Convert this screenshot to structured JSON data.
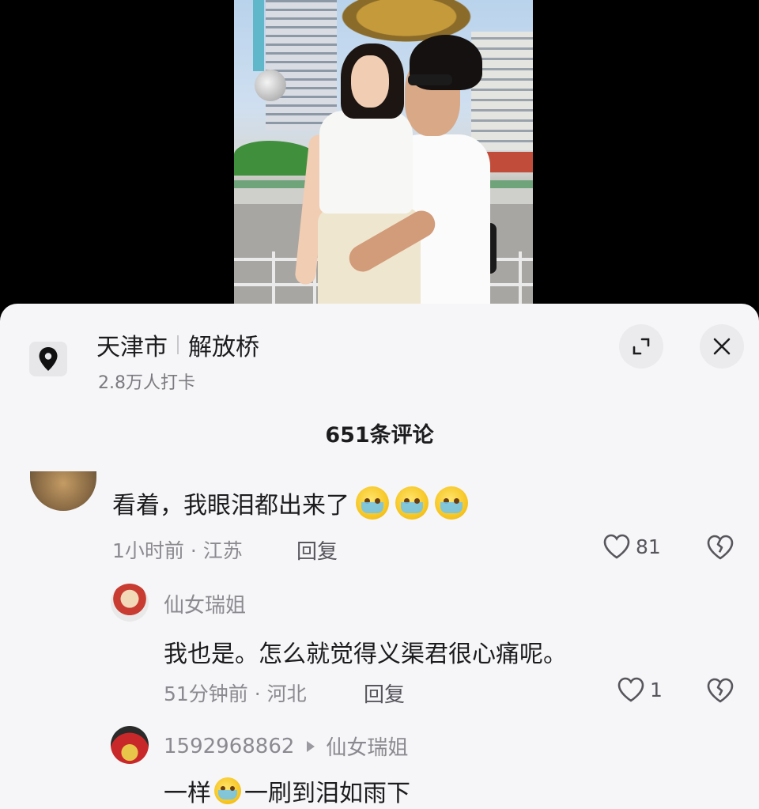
{
  "location": {
    "city": "天津市",
    "place": "解放桥",
    "checkins": "2.8万人打卡"
  },
  "comments_header": {
    "count_label": "651条评论"
  },
  "comments": [
    {
      "text": "看着，我眼泪都出来了",
      "emojis": [
        "pleading-tears",
        "pleading-tears",
        "pleading-tears"
      ],
      "meta": "1小时前 · 江苏",
      "reply_label": "回复",
      "likes": "81"
    }
  ],
  "replies": [
    {
      "username": "仙女瑞姐",
      "text": "我也是。怎么就觉得义渠君很心痛呢。",
      "meta": "51分钟前 · 河北",
      "reply_label": "回复",
      "likes": "1"
    },
    {
      "username": "1592968862",
      "reply_to": "仙女瑞姐",
      "text_before": "一样",
      "emoji": "crying-face",
      "text_after": "一刷到泪如雨下"
    }
  ],
  "icons": {
    "location": "map-pin-icon",
    "expand": "expand-icon",
    "close": "close-icon",
    "like": "heart-outline-icon",
    "dislike": "broken-heart-icon"
  },
  "colors": {
    "panel_bg": "#f6f6f8",
    "text": "#1c1c1e",
    "muted": "#8a8a90"
  }
}
